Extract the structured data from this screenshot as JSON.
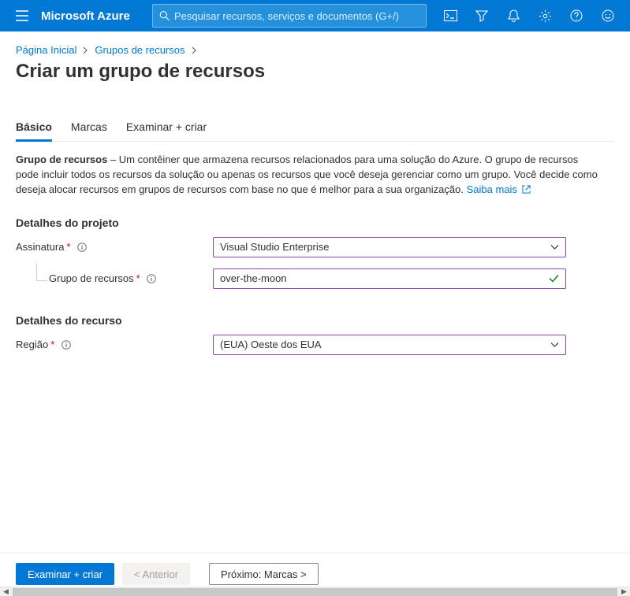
{
  "topbar": {
    "brand": "Microsoft Azure",
    "search_placeholder": "Pesquisar recursos, serviços e documentos (G+/)"
  },
  "breadcrumb": {
    "home": "Página Inicial",
    "group": "Grupos de recursos"
  },
  "page_title": "Criar um grupo de recursos",
  "tabs": {
    "basic": "Básico",
    "tags": "Marcas",
    "review": "Examinar + criar"
  },
  "desc": {
    "label": "Grupo de recursos",
    "text": " – Um contêiner que armazena recursos relacionados para uma solução do Azure. O grupo de recursos pode incluir todos os recursos da solução ou apenas os recursos que você deseja gerenciar como um grupo. Você decide como deseja alocar recursos em grupos de recursos com base no que é melhor para a sua organização. ",
    "link": "Saiba mais"
  },
  "sections": {
    "project": "Detalhes do projeto",
    "resource": "Detalhes do recurso"
  },
  "fields": {
    "subscription_label": "Assinatura",
    "subscription_value": "Visual Studio Enterprise",
    "rg_label": "Grupo de recursos",
    "rg_value": "over-the-moon",
    "region_label": "Região",
    "region_value": "(EUA) Oeste dos EUA"
  },
  "footer": {
    "review": "Examinar + criar",
    "prev": "< Anterior",
    "next": "Próximo: Marcas >"
  }
}
